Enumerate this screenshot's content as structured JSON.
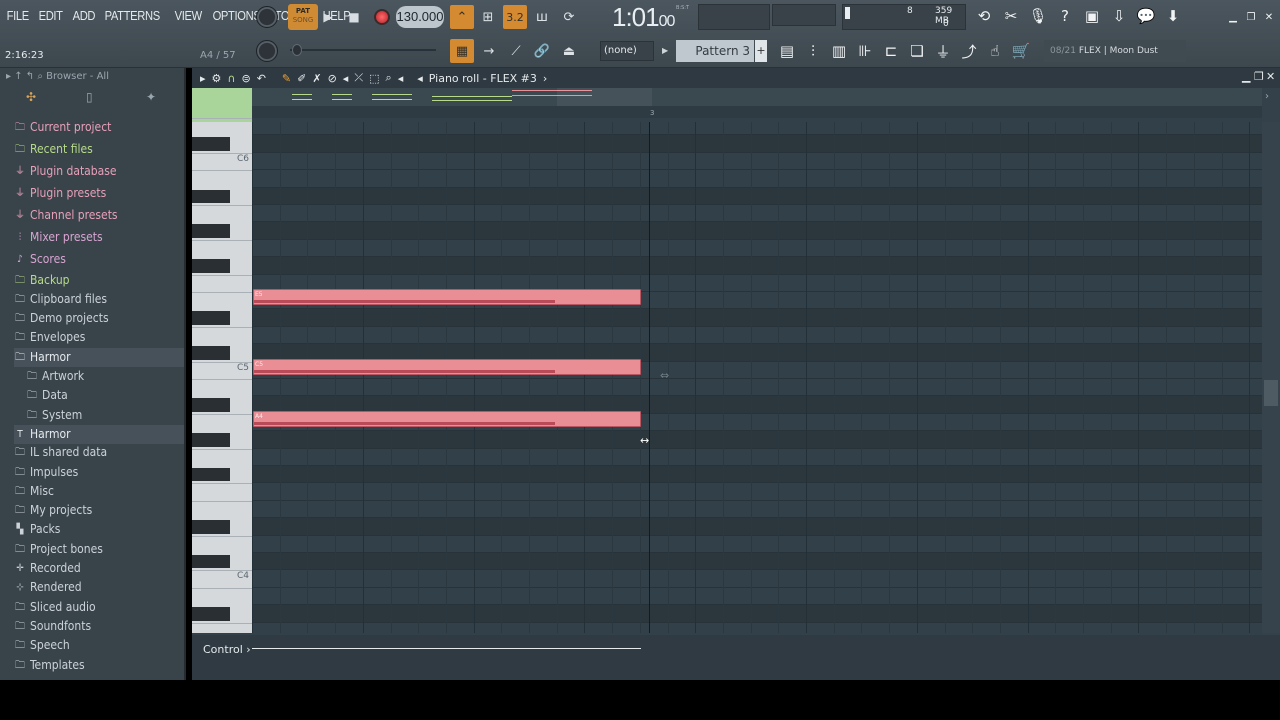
{
  "menu": [
    "FILE",
    "EDIT",
    "ADD",
    "PATTERNS",
    "VIEW",
    "OPTIONS",
    "TOOLS",
    "HELP"
  ],
  "transport": {
    "pat_label": "PAT",
    "song_label": "SONG",
    "tempo": "130.000",
    "time": "1:01",
    "time_ticks": "00",
    "time_mode": "B:S:T",
    "snap_value": "3.2"
  },
  "monitor": {
    "voices": "8",
    "memory": "359 MB",
    "cpu": "0"
  },
  "hint": {
    "position": "2:16:23",
    "key": "A4 / 57"
  },
  "toolbar2": {
    "snap": "(none)",
    "pattern": "Pattern 3",
    "plus": "+",
    "plugin_index": "08/21",
    "plugin_name": "FLEX | Moon Dust"
  },
  "browser": {
    "title": "Browser - All",
    "items": [
      {
        "label": "Current project",
        "color": "#e7a0b9",
        "icon": "folder-icon"
      },
      {
        "label": "Recent files",
        "color": "#b7db8a",
        "icon": "folder-icon"
      },
      {
        "label": "Plugin database",
        "color": "#e7a0b9",
        "icon": "plug-icon"
      },
      {
        "label": "Plugin presets",
        "color": "#e7a0b9",
        "icon": "plug-icon"
      },
      {
        "label": "Channel presets",
        "color": "#e7a0b9",
        "icon": "plug-icon"
      },
      {
        "label": "Mixer presets",
        "color": "#d6a5d0",
        "icon": "mixer-icon"
      },
      {
        "label": "Scores",
        "color": "#d6a5d0",
        "icon": "note-icon"
      },
      {
        "label": "Backup",
        "color": "#b7db8a",
        "icon": "folder-icon"
      },
      {
        "label": "Clipboard files",
        "color": "#cbd3d8",
        "icon": "folder-icon"
      },
      {
        "label": "Demo projects",
        "color": "#cbd3d8",
        "icon": "folder-icon"
      },
      {
        "label": "Envelopes",
        "color": "#cbd3d8",
        "icon": "folder-icon"
      },
      {
        "label": "Harmor",
        "color": "#e4e9ec",
        "icon": "folder-icon"
      },
      {
        "label": "Artwork",
        "color": "#cbd3d8",
        "icon": "folder-icon"
      },
      {
        "label": "Data",
        "color": "#cbd3d8",
        "icon": "folder-icon"
      },
      {
        "label": "System",
        "color": "#cbd3d8",
        "icon": "folder-icon"
      },
      {
        "label": "Harmor",
        "color": "#e4e9ec",
        "icon": "text-icon"
      },
      {
        "label": "IL shared data",
        "color": "#cbd3d8",
        "icon": "folder-icon"
      },
      {
        "label": "Impulses",
        "color": "#cbd3d8",
        "icon": "folder-icon"
      },
      {
        "label": "Misc",
        "color": "#cbd3d8",
        "icon": "folder-icon"
      },
      {
        "label": "My projects",
        "color": "#cbd3d8",
        "icon": "folder-icon"
      },
      {
        "label": "Packs",
        "color": "#cbd3d8",
        "icon": "pack-icon"
      },
      {
        "label": "Project bones",
        "color": "#cbd3d8",
        "icon": "folder-icon"
      },
      {
        "label": "Recorded",
        "color": "#cbd3d8",
        "icon": "recorded-icon"
      },
      {
        "label": "Rendered",
        "color": "#cbd3d8",
        "icon": "rendered-icon"
      },
      {
        "label": "Sliced audio",
        "color": "#cbd3d8",
        "icon": "folder-icon"
      },
      {
        "label": "Soundfonts",
        "color": "#cbd3d8",
        "icon": "folder-icon"
      },
      {
        "label": "Speech",
        "color": "#cbd3d8",
        "icon": "folder-icon"
      },
      {
        "label": "Templates",
        "color": "#cbd3d8",
        "icon": "folder-icon"
      }
    ]
  },
  "pianoroll": {
    "title": "Piano roll - FLEX #3",
    "bar_marker": "3",
    "control_label": "Control",
    "key_labels": [
      "C6",
      "C5",
      "C4"
    ],
    "notes": [
      {
        "label": "E5",
        "pitch": "E5"
      },
      {
        "label": "C5",
        "pitch": "C5"
      },
      {
        "label": "A4",
        "pitch": "A4"
      }
    ]
  },
  "colors": {
    "accent": "#d48a30",
    "note": "#ea8e96",
    "record": "#e0323c"
  }
}
